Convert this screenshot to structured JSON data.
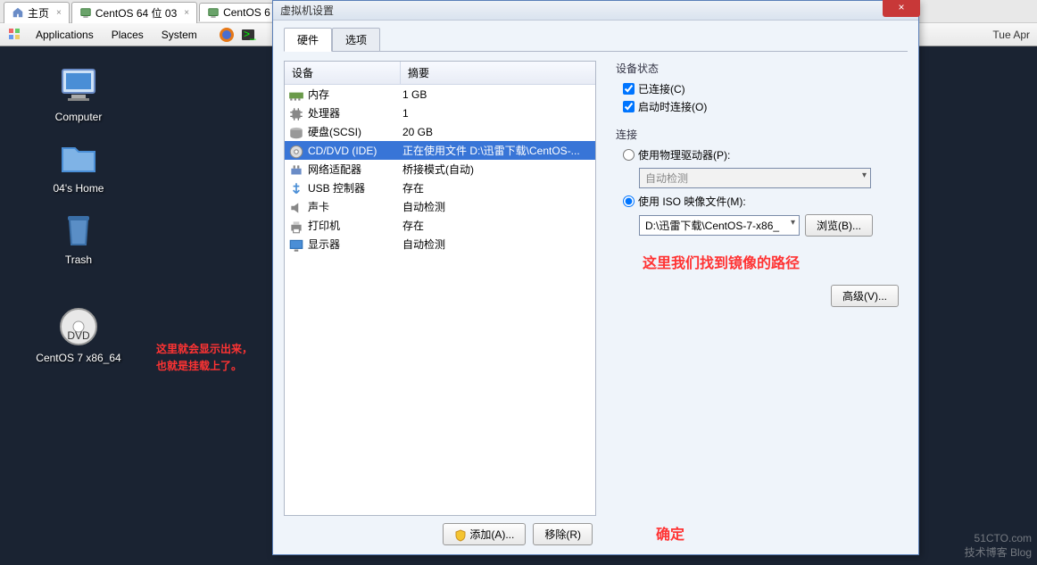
{
  "browser_tabs": [
    {
      "label": "主页",
      "icon": "home"
    },
    {
      "label": "CentOS 64 位  03",
      "icon": "vm"
    },
    {
      "label": "CentOS 6",
      "icon": "vm"
    }
  ],
  "gnome": {
    "apps_icon": "apps",
    "applications": "Applications",
    "places": "Places",
    "system": "System",
    "clock": "Tue Apr"
  },
  "desktop_icons": {
    "computer": "Computer",
    "home": "04's Home",
    "trash": "Trash",
    "cd": "CentOS 7 x86_64"
  },
  "annotations": {
    "left_line1": "这里就会显示出来，",
    "left_line2": "也就是挂载上了。",
    "right": "这里我们找到镜像的路径",
    "confirm": "确定"
  },
  "dialog": {
    "title": "虚拟机设置",
    "close": "×",
    "tabs": {
      "hardware": "硬件",
      "options": "选项"
    },
    "hw_header": {
      "device": "设备",
      "summary": "摘要"
    },
    "hw_rows": [
      {
        "name": "内存",
        "summary": "1 GB",
        "icon": "memory"
      },
      {
        "name": "处理器",
        "summary": "1",
        "icon": "cpu"
      },
      {
        "name": "硬盘(SCSI)",
        "summary": "20 GB",
        "icon": "disk"
      },
      {
        "name": "CD/DVD (IDE)",
        "summary": "正在使用文件 D:\\迅雷下载\\CentOS-...",
        "icon": "cd",
        "selected": true
      },
      {
        "name": "网络适配器",
        "summary": "桥接模式(自动)",
        "icon": "net"
      },
      {
        "name": "USB 控制器",
        "summary": "存在",
        "icon": "usb"
      },
      {
        "name": "声卡",
        "summary": "自动检测",
        "icon": "sound"
      },
      {
        "name": "打印机",
        "summary": "存在",
        "icon": "printer"
      },
      {
        "name": "显示器",
        "summary": "自动检测",
        "icon": "display"
      }
    ],
    "add_btn": "添加(A)...",
    "remove_btn": "移除(R)",
    "right": {
      "device_state": "设备状态",
      "connected": "已连接(C)",
      "connect_at_poweron": "启动时连接(O)",
      "connection": "连接",
      "use_physical": "使用物理驱动器(P):",
      "auto_detect": "自动检测",
      "use_iso": "使用 ISO 映像文件(M):",
      "iso_path": "D:\\迅雷下载\\CentOS-7-x86_",
      "browse": "浏览(B)...",
      "advanced": "高级(V)..."
    }
  },
  "watermark": {
    "line1": "51CTO.com",
    "line2": "技术博客    Blog"
  }
}
